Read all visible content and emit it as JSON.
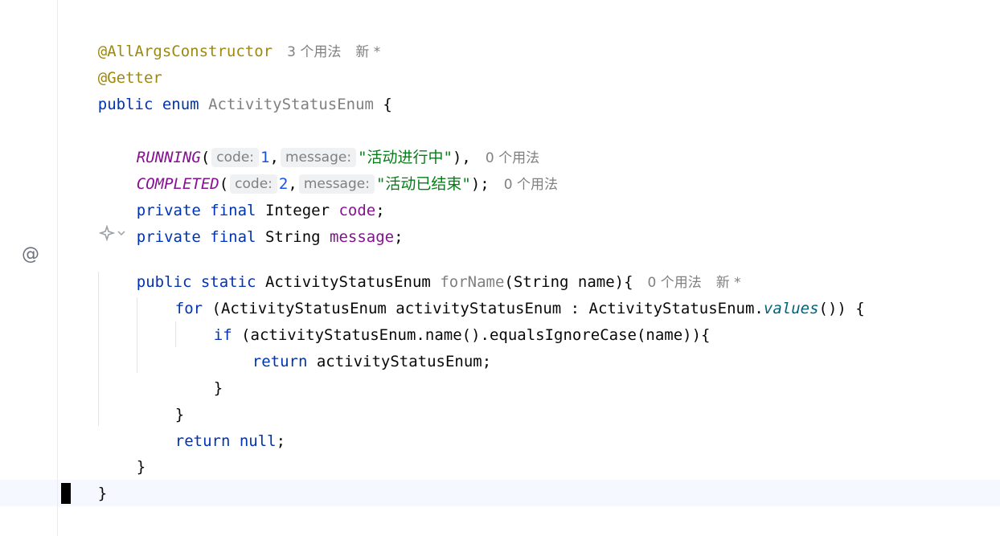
{
  "editor": {
    "l1": {
      "annotation": "@AllArgsConstructor",
      "usages": "3 个用法",
      "new_label": "新 *"
    },
    "l2": {
      "annotation": "@Getter"
    },
    "l3": {
      "kw_public": "public",
      "kw_enum": "enum",
      "class_name": "ActivityStatusEnum",
      "brace": " {"
    },
    "l5": {
      "name": "RUNNING",
      "paren_open": "(",
      "hint_code": "code:",
      "code_value": "1",
      "comma": ",",
      "hint_message": "message:",
      "message_value": "\"活动进行中\"",
      "tail": "),",
      "usages": "0 个用法"
    },
    "l6": {
      "name": "COMPLETED",
      "paren_open": "(",
      "hint_code": "code:",
      "code_value": "2",
      "comma": ",",
      "hint_message": "message:",
      "message_value": "\"活动已结束\"",
      "tail": ");",
      "usages": "0 个用法"
    },
    "l7": {
      "kw_private": "private",
      "kw_final": "final",
      "type": "Integer",
      "field": "code",
      "semi": ";"
    },
    "l8": {
      "kw_private": "private",
      "kw_final": "final",
      "type": "String",
      "field": "message",
      "semi": ";"
    },
    "l9": {
      "kw_public": "public",
      "kw_static": "static",
      "type": "ActivityStatusEnum",
      "method": "forName",
      "params": "(String name){",
      "usages": "0 个用法",
      "new_label": "新 *"
    },
    "l10": {
      "kw_for": "for",
      "head": " (ActivityStatusEnum activityStatusEnum : ActivityStatusEnum.",
      "call": "values",
      "tail": "()) {"
    },
    "l11": {
      "kw_if": "if",
      "rest": " (activityStatusEnum.name().equalsIgnoreCase(name)){"
    },
    "l12": {
      "kw_return": "return",
      "rest": " activityStatusEnum;"
    },
    "l13": {
      "brace": "}"
    },
    "l14": {
      "brace": "}"
    },
    "l15": {
      "kw_return": "return",
      "kw_null": "null",
      "semi": ";"
    },
    "l16": {
      "brace": "}"
    },
    "l17": {
      "brace": "}"
    },
    "gutter": {
      "override_marker": "@",
      "ai_icon": "ai-assistant-icon",
      "dropdown_icon": "chevron-down-icon"
    }
  }
}
